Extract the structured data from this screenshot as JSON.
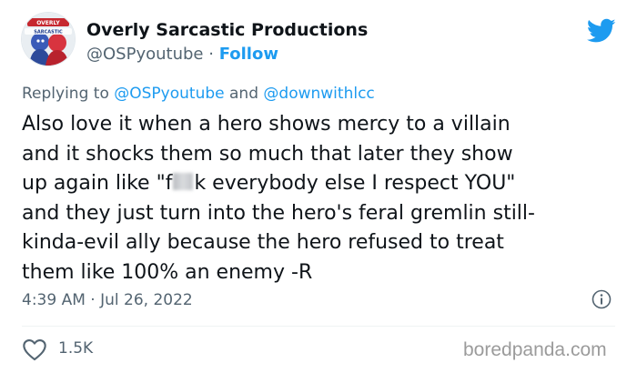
{
  "account": {
    "display_name": "Overly Sarcastic Productions",
    "handle": "@OSPyoutube",
    "separator": "·",
    "follow_label": "Follow",
    "avatar_text": "OVERLY SARCASTIC PRODUCTIONS"
  },
  "reply": {
    "prefix": "Replying to",
    "mention_1": "@OSPyoutube",
    "and": "and",
    "mention_2": "@downwithlcc"
  },
  "tweet": {
    "line_1": "Also love it when a hero shows mercy to a villain",
    "line_2": "and it shocks them so much that later they show",
    "line_3_before": "up again like \"f",
    "line_3_after": "k everybody else I respect YOU\"",
    "line_4": "and they just turn into the hero's feral gremlin still-",
    "line_5": "kinda-evil ally because the hero refused to treat",
    "line_6": "them like 100% an enemy -R"
  },
  "meta": {
    "timestamp": "4:39 AM · Jul 26, 2022",
    "like_count": "1.5K"
  },
  "watermark": "boredpanda.com",
  "icons": {
    "brand": "twitter-bird-icon",
    "info": "info-icon",
    "like": "heart-icon"
  },
  "colors": {
    "accent": "#1d9bf0",
    "secondary_text": "#536471",
    "primary_text": "#0f1419",
    "watermark": "#9b9b9b"
  }
}
